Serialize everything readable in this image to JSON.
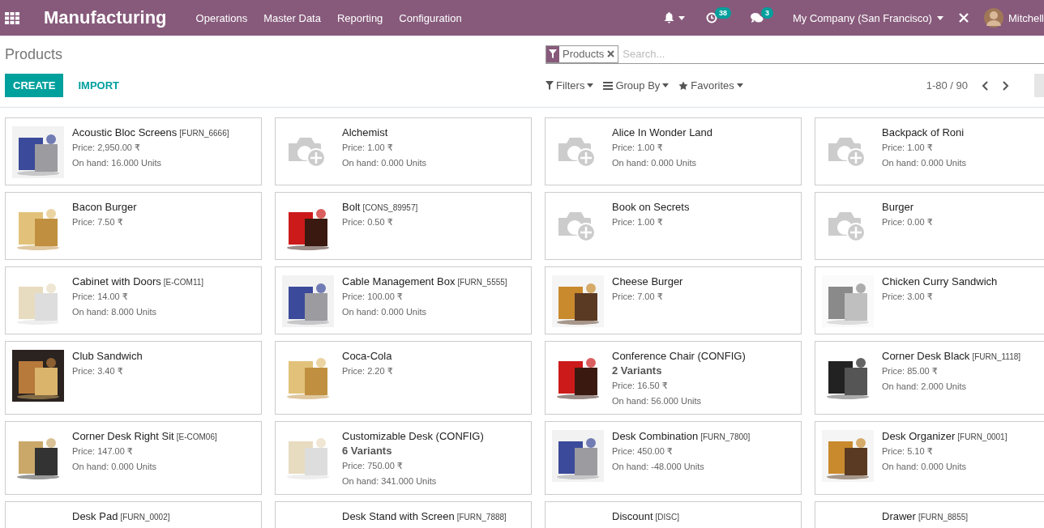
{
  "topbar": {
    "app_name": "Manufacturing",
    "menu": [
      "Operations",
      "Master Data",
      "Reporting",
      "Configuration"
    ],
    "activity_count": "38",
    "message_count": "3",
    "company": "My Company (San Francisco)",
    "user": "Mitchell"
  },
  "control_panel": {
    "breadcrumb": "Products",
    "search": {
      "facet": "Products",
      "placeholder": "Search..."
    },
    "buttons": [
      {
        "label": "CREATE",
        "kind": "primary"
      },
      {
        "label": "IMPORT",
        "kind": "link"
      }
    ],
    "filters": [
      {
        "label": "Filters",
        "kind": "filter"
      },
      {
        "label": "Group By",
        "kind": "group"
      },
      {
        "label": "Favorites",
        "kind": "favorite"
      }
    ],
    "pager": "1-80 / 90"
  },
  "products": [
    {
      "name": "Acoustic Bloc Screens",
      "code": "[FURN_6666]",
      "price": "Price: 2,950.00 ₹",
      "on_hand": "On hand: 16.000 Units",
      "kind": "picture"
    },
    {
      "name": "Alchemist",
      "price": "Price: 1.00 ₹",
      "on_hand": "On hand: 0.000 Units",
      "kind": "placeholder"
    },
    {
      "name": "Alice In Wonder Land",
      "price": "Price: 1.00 ₹",
      "on_hand": "On hand: 0.000 Units",
      "kind": "placeholder"
    },
    {
      "name": "Backpack of Roni",
      "price": "Price: 1.00 ₹",
      "on_hand": "On hand: 0.000 Units",
      "kind": "placeholder"
    },
    {
      "name": "Bacon Burger",
      "price": "Price: 7.50 ₹",
      "kind": "picture"
    },
    {
      "name": "Bolt",
      "code": "[CONS_89957]",
      "price": "Price: 0.50 ₹",
      "kind": "picture"
    },
    {
      "name": "Book on Secrets",
      "price": "Price: 1.00 ₹",
      "kind": "placeholder"
    },
    {
      "name": "Burger",
      "price": "Price: 0.00 ₹",
      "kind": "placeholder"
    },
    {
      "name": "Cabinet with Doors",
      "code": "[E-COM11]",
      "price": "Price: 14.00 ₹",
      "on_hand": "On hand: 8.000 Units",
      "kind": "picture"
    },
    {
      "name": "Cable Management Box",
      "code": "[FURN_5555]",
      "price": "Price: 100.00 ₹",
      "on_hand": "On hand: 0.000 Units",
      "kind": "picture"
    },
    {
      "name": "Cheese Burger",
      "price": "Price: 7.00 ₹",
      "kind": "picture"
    },
    {
      "name": "Chicken Curry Sandwich",
      "price": "Price: 3.00 ₹",
      "kind": "picture"
    },
    {
      "name": "Club Sandwich",
      "price": "Price: 3.40 ₹",
      "kind": "picture"
    },
    {
      "name": "Coca-Cola",
      "price": "Price: 2.20 ₹",
      "kind": "picture"
    },
    {
      "name": "Conference Chair (CONFIG)",
      "variants": "2 Variants",
      "price": "Price: 16.50 ₹",
      "on_hand": "On hand: 56.000 Units",
      "kind": "picture"
    },
    {
      "name": "Corner Desk Black",
      "code": "[FURN_1118]",
      "price": "Price: 85.00 ₹",
      "on_hand": "On hand: 2.000 Units",
      "kind": "picture"
    },
    {
      "name": "Corner Desk Right Sit",
      "code": "[E-COM06]",
      "price": "Price: 147.00 ₹",
      "on_hand": "On hand: 0.000 Units",
      "kind": "picture"
    },
    {
      "name": "Customizable Desk (CONFIG)",
      "variants": "6 Variants",
      "price": "Price: 750.00 ₹",
      "on_hand": "On hand: 341.000 Units",
      "kind": "picture"
    },
    {
      "name": "Desk Combination",
      "code": "[FURN_7800]",
      "price": "Price: 450.00 ₹",
      "on_hand": "On hand: -48.000 Units",
      "kind": "picture"
    },
    {
      "name": "Desk Organizer",
      "code": "[FURN_0001]",
      "price": "Price: 5.10 ₹",
      "on_hand": "On hand: 0.000 Units",
      "kind": "picture"
    },
    {
      "name": "Desk Pad",
      "code": "[FURN_0002]"
    },
    {
      "name": "Desk Stand with Screen",
      "code": "[FURN_7888]"
    },
    {
      "name": "Discount",
      "code": "[DISC]"
    },
    {
      "name": "Drawer",
      "code": "[FURN_8855]"
    }
  ]
}
